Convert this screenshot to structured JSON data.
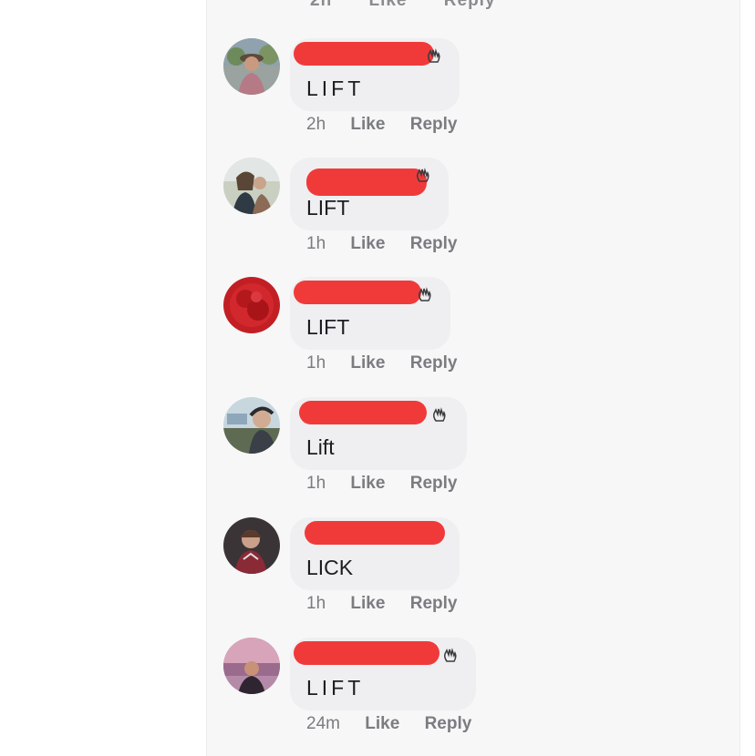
{
  "top_partial": {
    "time": "2h",
    "like": "Like",
    "reply": "Reply"
  },
  "comments": [
    {
      "text": "LIFT",
      "time": "2h",
      "like": "Like",
      "reply": "Reply"
    },
    {
      "text": "LIFT",
      "time": "1h",
      "like": "Like",
      "reply": "Reply"
    },
    {
      "text": "LIFT",
      "time": "1h",
      "like": "Like",
      "reply": "Reply"
    },
    {
      "text": "Lift",
      "time": "1h",
      "like": "Like",
      "reply": "Reply"
    },
    {
      "text": "LICK",
      "time": "1h",
      "like": "Like",
      "reply": "Reply"
    },
    {
      "text": "LIFT",
      "time": "24m",
      "like": "Like",
      "reply": "Reply"
    }
  ],
  "colors": {
    "redaction": "#f03a3a",
    "bubble": "#efeff1",
    "meta": "#7b7c80"
  },
  "icons": [
    "waving-hand-icon"
  ]
}
